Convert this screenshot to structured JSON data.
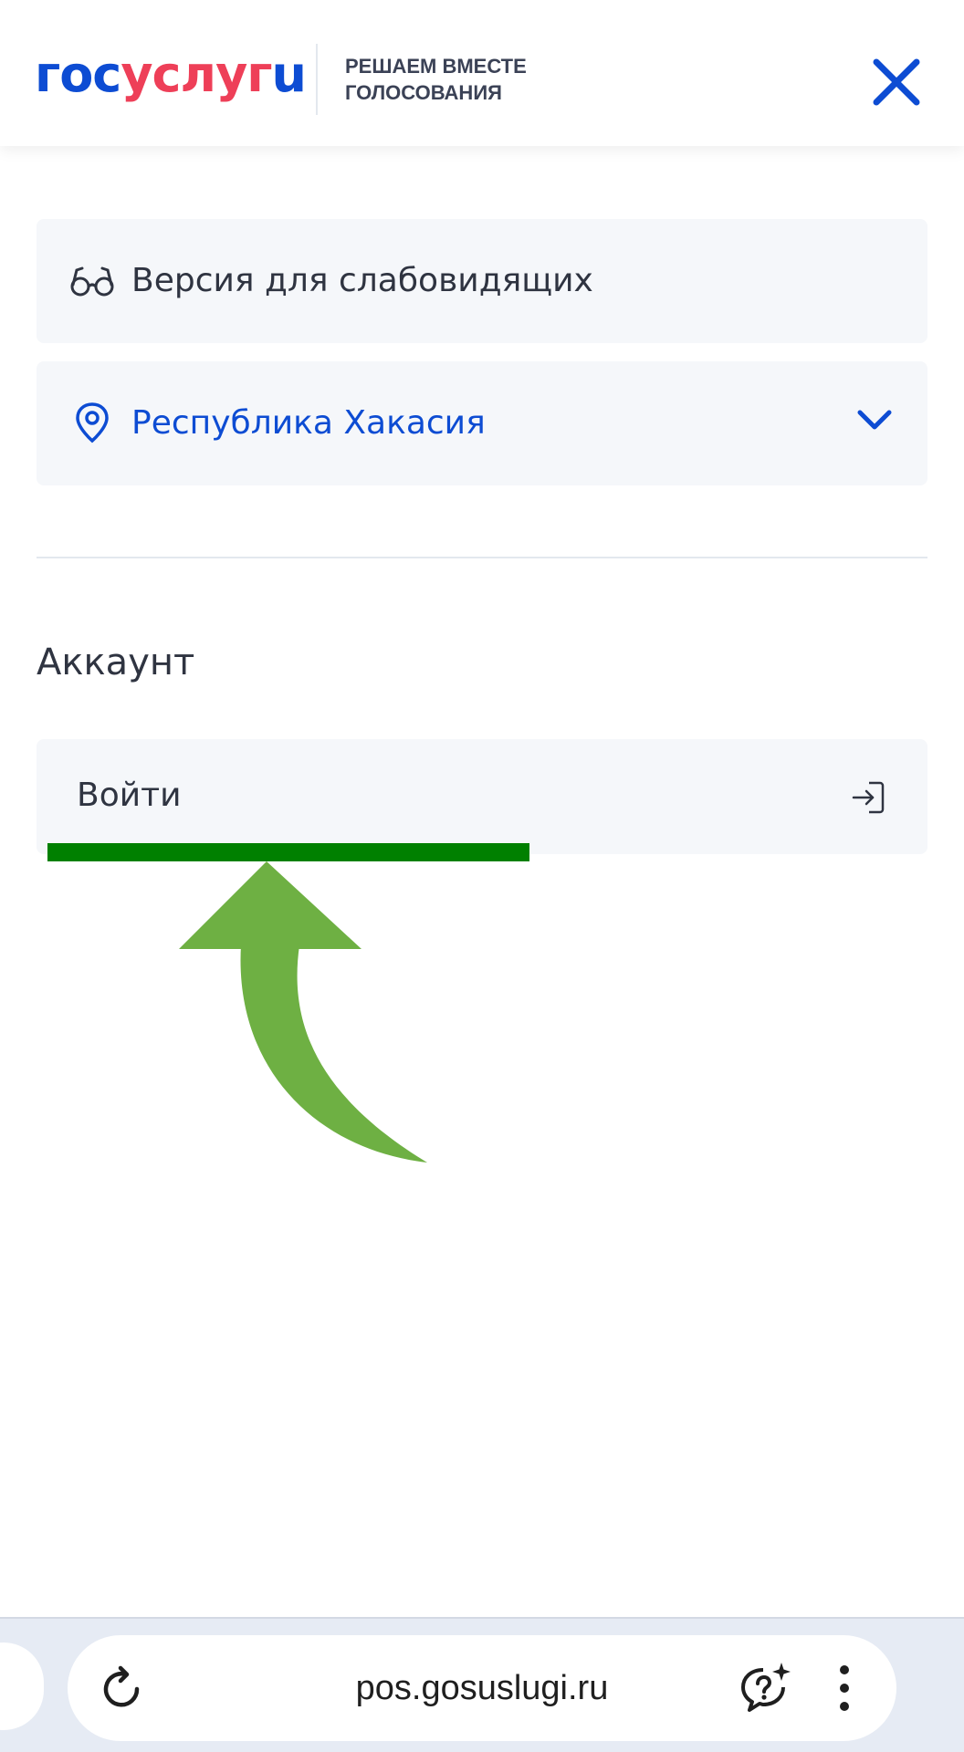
{
  "header": {
    "logo_part1": "гос",
    "logo_part2": "услуг",
    "logo_part3": "u",
    "tagline_line1": "РЕШАЕМ ВМЕСТЕ",
    "tagline_line2": "ГОЛОСОВАНИЯ",
    "close_icon": "close-icon"
  },
  "menu": {
    "vision_label": "Версия для слабовидящих",
    "vision_icon": "glasses-icon",
    "region_label": "Республика Хакасия",
    "region_icon": "location-pin-icon",
    "region_chevron_icon": "chevron-down-icon"
  },
  "account": {
    "title": "Аккаунт",
    "login_label": "Войти",
    "login_icon": "login-icon"
  },
  "browser": {
    "url": "pos.gosuslugi.ru",
    "reload_icon": "reload-icon",
    "assist_icon": "assistant-icon",
    "menu_icon": "more-vertical-icon"
  },
  "colors": {
    "brand_blue": "#0d4cd3",
    "brand_red": "#ee3f58",
    "annotation_green": "#008000",
    "arrow_green": "#6eb043",
    "card_bg": "#f5f7fa"
  }
}
